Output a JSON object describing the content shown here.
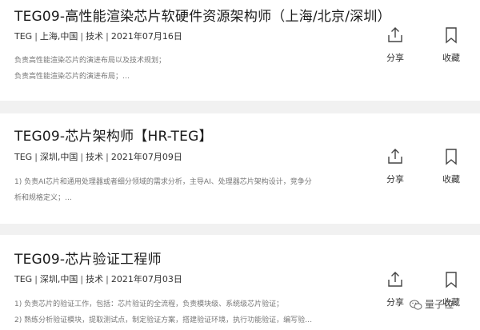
{
  "jobs": [
    {
      "title": "TEG09-高性能渲染芯片软硬件资源架构师（上海/北京/深圳）",
      "dept": "TEG",
      "location": "上海,中国",
      "category": "技术",
      "date": "2021年07月16日",
      "desc": [
        "负责高性能渲染芯片的演进布局以及技术规划；",
        "负责高性能渲染芯片的演进布局；…"
      ]
    },
    {
      "title": "TEG09-芯片架构师【HR-TEG】",
      "dept": "TEG",
      "location": "深圳,中国",
      "category": "技术",
      "date": "2021年07月09日",
      "desc": [
        "1) 负责AI芯片和通用处理器或者细分领域的需求分析，主导AI、处理器芯片架构设计，竞争分",
        "析和规格定义；…"
      ]
    },
    {
      "title": "TEG09-芯片验证工程师",
      "dept": "TEG",
      "location": "深圳,中国",
      "category": "技术",
      "date": "2021年07月03日",
      "desc": [
        "1) 负责芯片的验证工作，包括：芯片验证的全流程，负责模块级、系统级芯片验证；",
        "2) 熟练分析验证模块，提取测试点，制定验证方案，搭建验证环境，执行功能验证，编写验…"
      ]
    }
  ],
  "actions": {
    "share_label": "分享",
    "fav_label": "收藏",
    "share_icon": "share-icon",
    "fav_icon": "bookmark-icon"
  },
  "watermark": {
    "text": "量子位",
    "icon": "wechat-icon"
  }
}
